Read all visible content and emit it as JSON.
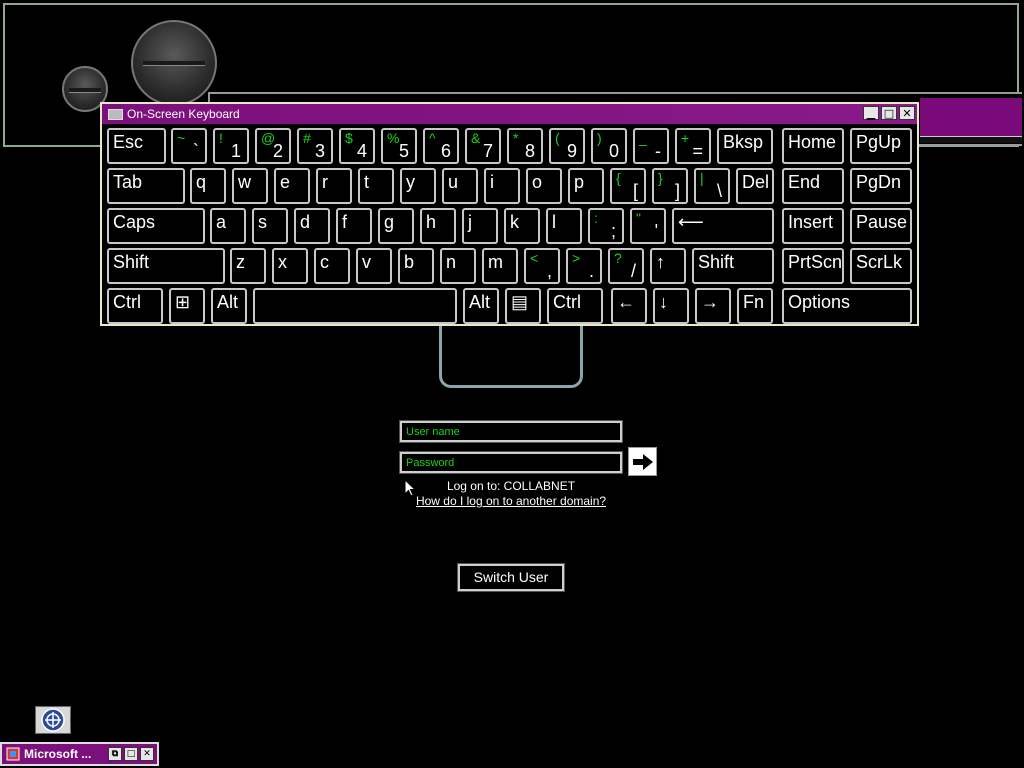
{
  "keyboard": {
    "title": "On-Screen Keyboard",
    "window_buttons": {
      "minimize": "▁",
      "maximize": "□",
      "close": "✕"
    },
    "rows": [
      [
        {
          "label": "Esc"
        },
        {
          "shift": "~",
          "base": "`"
        },
        {
          "shift": "!",
          "base": "1"
        },
        {
          "shift": "@",
          "base": "2"
        },
        {
          "shift": "#",
          "base": "3"
        },
        {
          "shift": "$",
          "base": "4"
        },
        {
          "shift": "%",
          "base": "5"
        },
        {
          "shift": "^",
          "base": "6"
        },
        {
          "shift": "&",
          "base": "7"
        },
        {
          "shift": "*",
          "base": "8"
        },
        {
          "shift": "(",
          "base": "9"
        },
        {
          "shift": ")",
          "base": "0"
        },
        {
          "shift": "_",
          "base": "-"
        },
        {
          "shift": "+",
          "base": "="
        },
        {
          "label": "Bksp"
        },
        {
          "label": "Home"
        },
        {
          "label": "PgUp"
        }
      ],
      [
        {
          "label": "Tab"
        },
        {
          "label": "q"
        },
        {
          "label": "w"
        },
        {
          "label": "e"
        },
        {
          "label": "r"
        },
        {
          "label": "t"
        },
        {
          "label": "y"
        },
        {
          "label": "u"
        },
        {
          "label": "i"
        },
        {
          "label": "o"
        },
        {
          "label": "p"
        },
        {
          "shift": "{",
          "base": "["
        },
        {
          "shift": "}",
          "base": "]"
        },
        {
          "shift": "|",
          "base": "\\"
        },
        {
          "label": "Del"
        },
        {
          "label": "End"
        },
        {
          "label": "PgDn"
        }
      ],
      [
        {
          "label": "Caps"
        },
        {
          "label": "a"
        },
        {
          "label": "s"
        },
        {
          "label": "d"
        },
        {
          "label": "f"
        },
        {
          "label": "g"
        },
        {
          "label": "h"
        },
        {
          "label": "j"
        },
        {
          "label": "k"
        },
        {
          "label": "l"
        },
        {
          "shift": ":",
          "base": ";"
        },
        {
          "shift": "\"",
          "base": "'"
        },
        {
          "label": "⟵"
        },
        {
          "label": "Insert"
        },
        {
          "label": "Pause"
        }
      ],
      [
        {
          "label": "Shift"
        },
        {
          "label": "z"
        },
        {
          "label": "x"
        },
        {
          "label": "c"
        },
        {
          "label": "v"
        },
        {
          "label": "b"
        },
        {
          "label": "n"
        },
        {
          "label": "m"
        },
        {
          "shift": "<",
          "base": ","
        },
        {
          "shift": ">",
          "base": "."
        },
        {
          "shift": "?",
          "base": "/"
        },
        {
          "label": "↑"
        },
        {
          "label": "Shift"
        },
        {
          "label": "PrtScn"
        },
        {
          "label": "ScrLk"
        }
      ],
      [
        {
          "label": "Ctrl"
        },
        {
          "label": "⊞"
        },
        {
          "label": "Alt"
        },
        {
          "label": ""
        },
        {
          "label": "Alt"
        },
        {
          "label": "▤"
        },
        {
          "label": "Ctrl"
        },
        {
          "label": "←"
        },
        {
          "label": "↓"
        },
        {
          "label": "→"
        },
        {
          "label": "Fn"
        },
        {
          "label": "Options"
        }
      ]
    ]
  },
  "logon": {
    "username_placeholder": "User name",
    "password_placeholder": "Password",
    "logon_to": "Log on to: COLLABNET",
    "domain_link": "How do I log on to another domain?",
    "switch_user": "Switch User"
  },
  "taskbar": {
    "app_label": "Microsoft ..."
  },
  "colors": {
    "title_bar": "#7b0f7b",
    "shift_char": "#19d419",
    "field_text": "#19d419"
  }
}
